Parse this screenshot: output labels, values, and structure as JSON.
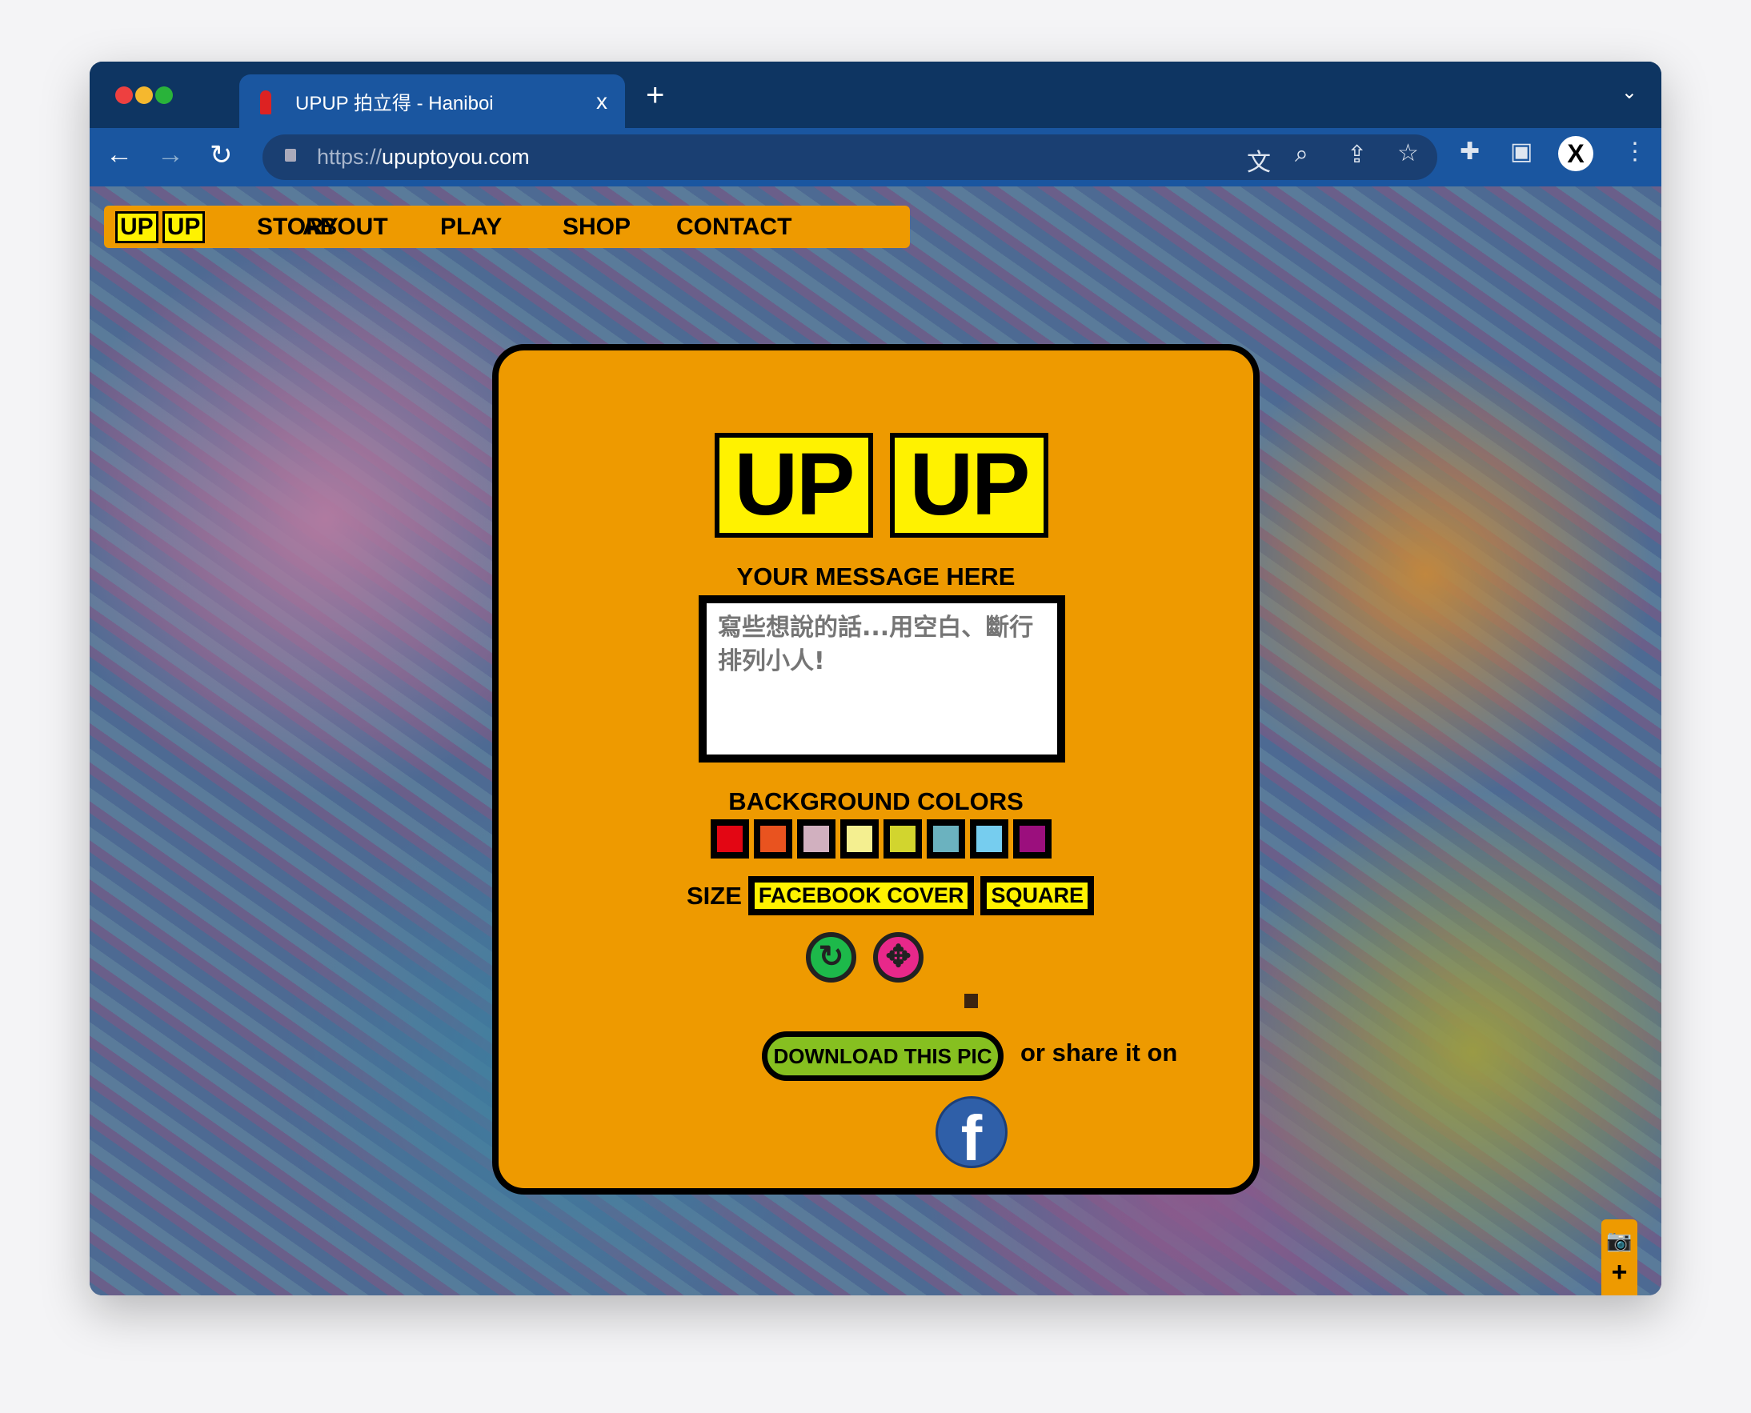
{
  "browser": {
    "tab_title": "UPUP 拍立得 - Haniboi",
    "url_protocol": "https://",
    "url_host": "upuptoyou.com",
    "new_tab": "+",
    "close": "x"
  },
  "nav": {
    "logo": [
      "UP",
      "UP"
    ],
    "items": [
      "STORY",
      "ABOUT",
      "PLAY",
      "SHOP",
      "CONTACT"
    ]
  },
  "modal": {
    "logo": [
      "UP",
      "UP"
    ],
    "message_label": "YOUR MESSAGE HERE",
    "message_placeholder": "寫些想說的話...用空白、斷行排列小人!",
    "bg_label": "BACKGROUND COLORS",
    "colors": [
      "#e30613",
      "#e9531f",
      "#d1b0bf",
      "#f4ef90",
      "#d2d52e",
      "#6bb2bf",
      "#76cdef",
      "#9b0f7d"
    ],
    "size_label": "SIZE",
    "size_options": [
      "FACEBOOK COVER",
      "SQUARE"
    ],
    "download": "DOWNLOAD THIS PIC",
    "share_text": "or share it on",
    "facebook": "f"
  },
  "icons": {
    "refresh": "refresh-icon",
    "move": "move-icon"
  },
  "zoom_controls": {
    "camera": "camera-icon",
    "plus": "+",
    "minus": "−"
  }
}
